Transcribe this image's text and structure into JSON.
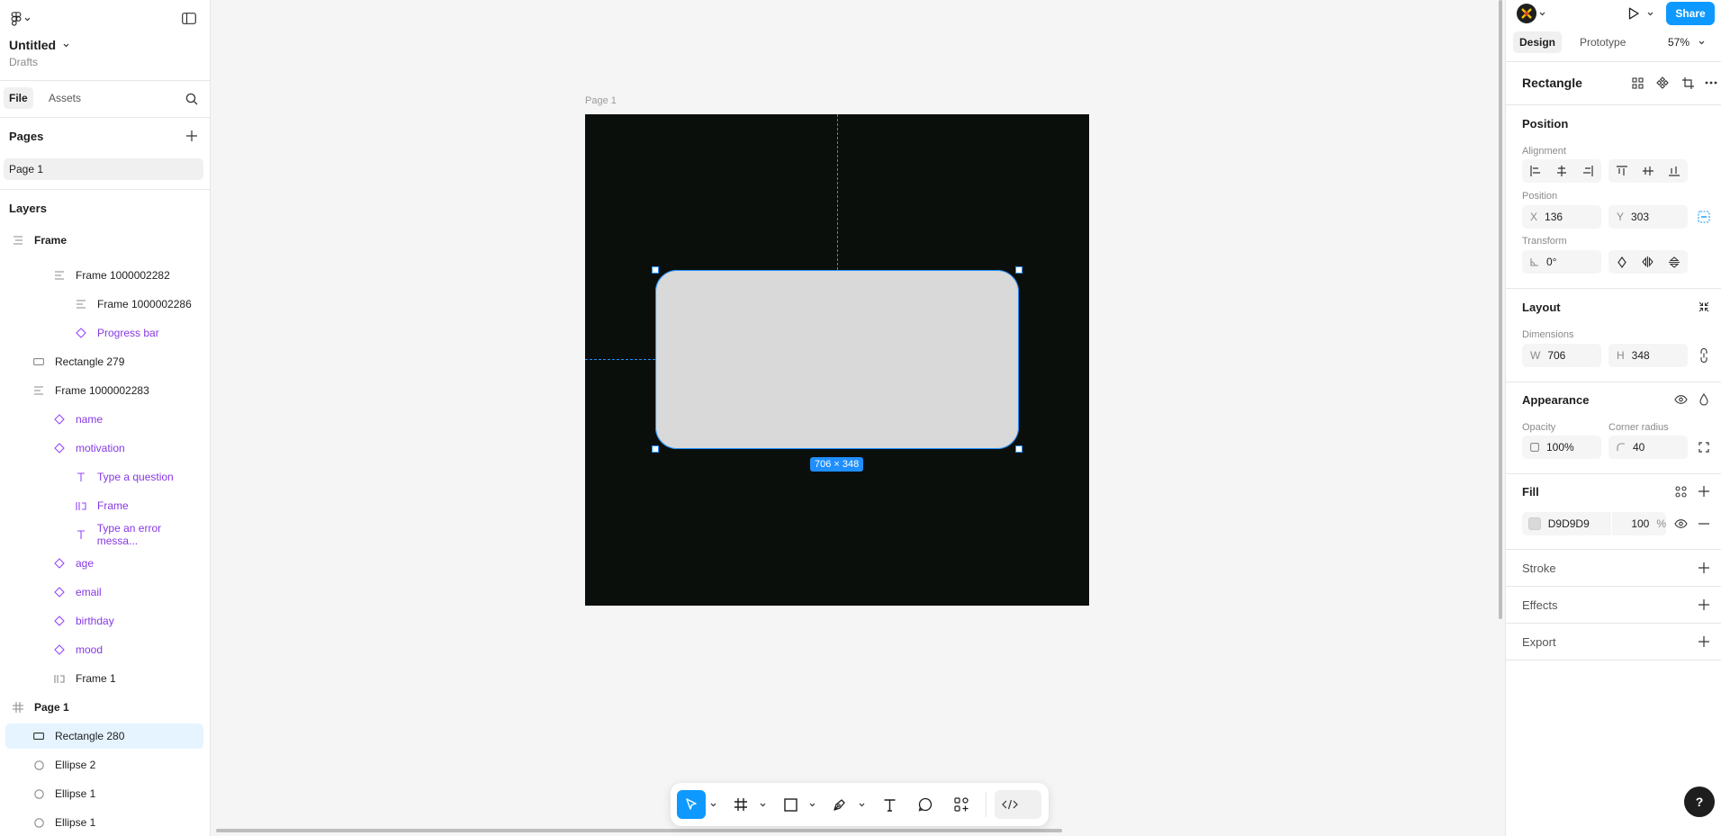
{
  "file": {
    "title": "Untitled",
    "location": "Drafts"
  },
  "left_tabs": {
    "file": "File",
    "assets": "Assets"
  },
  "pages": {
    "title": "Pages",
    "items": [
      "Page 1"
    ]
  },
  "layers": {
    "title": "Layers",
    "items": [
      {
        "label": "Frame",
        "kind": "frame"
      },
      {
        "label": "Frame 1000002282",
        "kind": "autolayout"
      },
      {
        "label": "Frame 1000002286",
        "kind": "autolayout"
      },
      {
        "label": "Progress bar",
        "kind": "component"
      },
      {
        "label": "Rectangle 279",
        "kind": "rect"
      },
      {
        "label": "Frame 1000002283",
        "kind": "autolayout"
      },
      {
        "label": "name",
        "kind": "component"
      },
      {
        "label": "motivation",
        "kind": "component"
      },
      {
        "label": "Type a question",
        "kind": "text"
      },
      {
        "label": "Frame",
        "kind": "frame-instance"
      },
      {
        "label": "Type an error messa...",
        "kind": "text"
      },
      {
        "label": "age",
        "kind": "component"
      },
      {
        "label": "email",
        "kind": "component"
      },
      {
        "label": "birthday",
        "kind": "component"
      },
      {
        "label": "mood",
        "kind": "component"
      },
      {
        "label": "Frame 1",
        "kind": "frame-instance"
      },
      {
        "label": "Page 1",
        "kind": "frame-grid"
      },
      {
        "label": "Rectangle 280",
        "kind": "rect"
      },
      {
        "label": "Ellipse 2",
        "kind": "ellipse"
      },
      {
        "label": "Ellipse 1",
        "kind": "ellipse"
      },
      {
        "label": "Ellipse 1",
        "kind": "ellipse"
      }
    ]
  },
  "canvas": {
    "frame_label": "Page 1",
    "selection_size": "706 × 348"
  },
  "header": {
    "share": "Share",
    "tab_design": "Design",
    "tab_prototype": "Prototype",
    "zoom": "57%"
  },
  "inspector": {
    "node_type": "Rectangle",
    "position": {
      "title": "Position",
      "alignment_label": "Alignment",
      "position_label": "Position",
      "x_prefix": "X",
      "x": "136",
      "y_prefix": "Y",
      "y": "303",
      "transform_label": "Transform",
      "rotation": "0°"
    },
    "layout": {
      "title": "Layout",
      "dimensions_label": "Dimensions",
      "w_prefix": "W",
      "w": "706",
      "h_prefix": "H",
      "h": "348"
    },
    "appearance": {
      "title": "Appearance",
      "opacity_label": "Opacity",
      "opacity": "100%",
      "radius_label": "Corner radius",
      "radius": "40"
    },
    "fill": {
      "title": "Fill",
      "hex": "D9D9D9",
      "opacity": "100",
      "unit": "%",
      "swatch": "#d9d9d9"
    },
    "stroke": {
      "title": "Stroke"
    },
    "effects": {
      "title": "Effects"
    },
    "export": {
      "title": "Export"
    }
  },
  "help": "?"
}
